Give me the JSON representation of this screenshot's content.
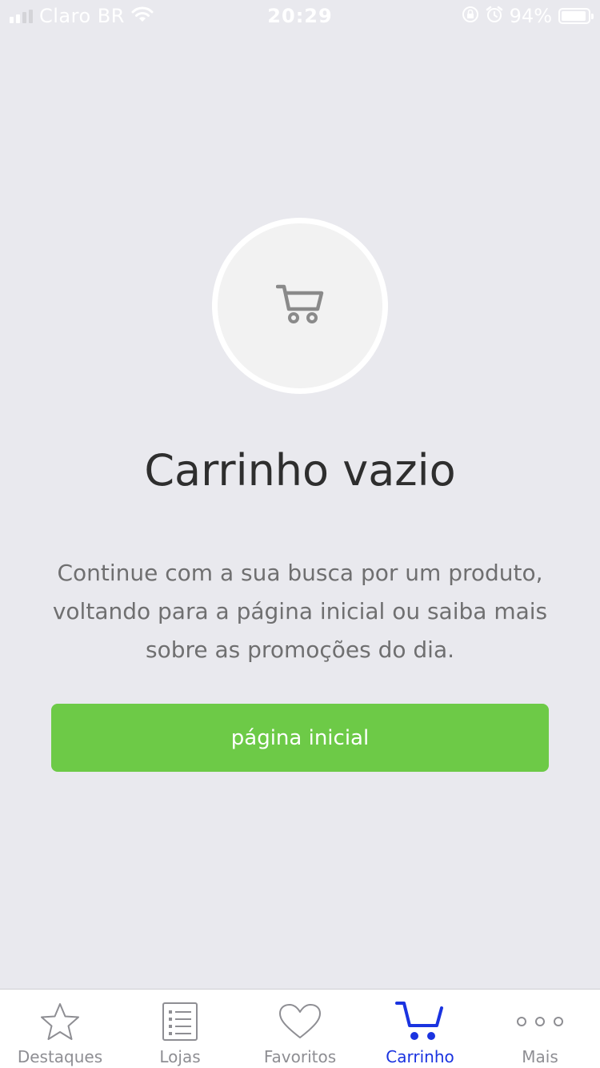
{
  "status_bar": {
    "carrier": "Claro BR",
    "time": "20:29",
    "battery_percent": "94%",
    "battery_level": 0.94,
    "signal_bars_filled": 2,
    "signal_bars_total": 4
  },
  "empty_cart": {
    "icon": "cart-icon",
    "title": "Carrinho vazio",
    "description": "Continue com a sua busca por um produto, voltando para a página inicial ou saiba mais sobre as promoções do dia.",
    "button_label": "página inicial"
  },
  "tab_bar": {
    "items": [
      {
        "label": "Destaques",
        "icon": "star-icon",
        "active": false
      },
      {
        "label": "Lojas",
        "icon": "list-icon",
        "active": false
      },
      {
        "label": "Favoritos",
        "icon": "heart-icon",
        "active": false
      },
      {
        "label": "Carrinho",
        "icon": "cart-icon",
        "active": true
      },
      {
        "label": "Mais",
        "icon": "more-icon",
        "active": false
      }
    ]
  },
  "colors": {
    "background": "#E9E9EE",
    "accent_green": "#6DCA47",
    "active_tab": "#1A33E0",
    "inactive_tab": "#8E8E93"
  }
}
